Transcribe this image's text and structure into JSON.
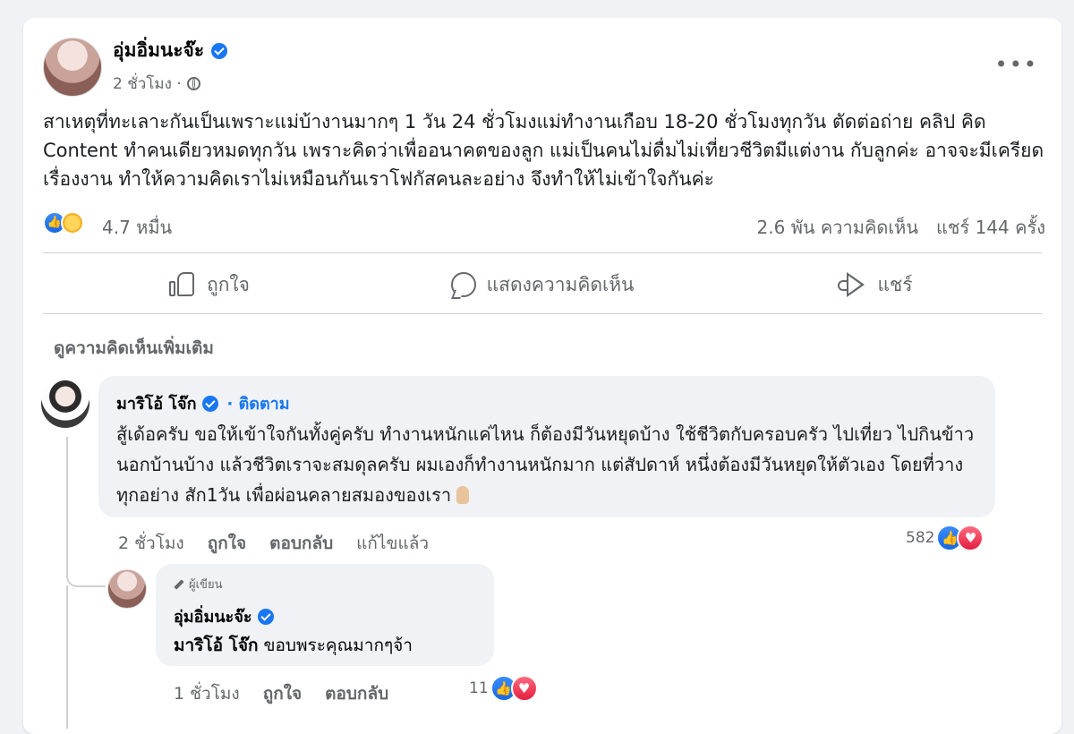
{
  "post": {
    "author": "อุ่มอิ่มนะจ๊ะ",
    "time": "2 ชั่วโมง ·",
    "more_label": "•••",
    "text": "สาเหตุที่ทะเลาะกันเป็นเพราะแม่บ้างานมากๆ 1 วัน 24 ชั่วโมงแม่ทำงานเกือบ 18-20 ชั่วโมงทุกวัน ตัดต่อถ่าย คลิป คิด Content ทำคนเดียวหมดทุกวัน เพราะคิดว่าเพื่ออนาคตของลูก แม่เป็นคนไม่ดื่มไม่เที่ยวชีวิตมีแต่งาน กับลูกค่ะ อาจจะมีเครียดเรื่องงาน ทำให้ความคิดเราไม่เหมือนกันเราโฟกัสคนละอย่าง จึงทำให้ไม่เข้าใจกันค่ะ",
    "reaction_count": "4.7 หมื่น",
    "comments_count": "2.6 พัน ความคิดเห็น",
    "shares_count": "แชร์ 144 ครั้ง"
  },
  "actions": {
    "like": "ถูกใจ",
    "comment": "แสดงความคิดเห็น",
    "share": "แชร์"
  },
  "more_comments": "ดูความคิดเห็นเพิ่มเติม",
  "comments": [
    {
      "author": "มาริโอ้ โจ๊ก",
      "follow": "· ติดตาม",
      "text": "สู้เด้อครับ ขอให้เข้าใจกันทั้งคู่ครับ ทำงานหนักแค่ไหน ก็ต้องมีวันหยุดบ้าง ใช้ชีวิตกับครอบครัว ไปเที่ยว ไปกินข้าวนอกบ้านบ้าง แล้วชีวิตเราจะสมดุลครับ ผมเองก็ทำงานหนักมาก แต่สัปดาห์ หนึ่งต้องมีวันหยุดให้ตัวเอง โดยที่วางทุกอย่าง สัก1วัน เพื่อผ่อนคลายสมองของเรา",
      "time": "2 ชั่วโมง",
      "like": "ถูกใจ",
      "reply": "ตอบกลับ",
      "edited": "แก้ไขแล้ว",
      "reactions": "582"
    },
    {
      "badge": "ผู้เขียน",
      "author": "อุ่มอิ่มนะจ๊ะ",
      "mention": "มาริโอ้ โจ๊ก",
      "text": " ขอบพระคุณมากๆจ้า",
      "time": "1 ชั่วโมง",
      "like": "ถูกใจ",
      "reply": "ตอบกลับ",
      "reactions": "11"
    }
  ],
  "colors": {
    "accent": "#1877f2",
    "love": "#e41e3f",
    "secondary_text": "#65676b",
    "bubble": "#f0f2f5"
  },
  "icons": [
    "verified-icon",
    "globe-icon",
    "like-reaction-icon",
    "care-reaction-icon",
    "love-reaction-icon",
    "thumb-icon",
    "comment-icon",
    "share-icon",
    "pencil-icon",
    "peace-hand-icon"
  ]
}
